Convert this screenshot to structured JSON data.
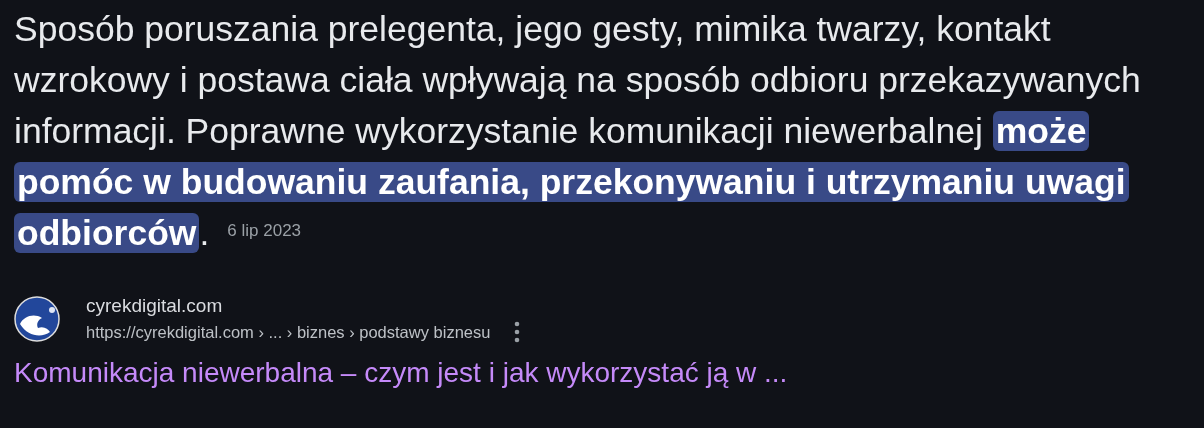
{
  "snippet": {
    "text": "Sposób poruszania prelegenta, jego gesty, mimika twarzy, kontakt wzrokowy i postawa ciała wpływają na sposób odbioru przekazywanych informacji. Poprawne wykorzystanie komunikacji niewerbalnej **może pomóc w budowaniu zaufania, przekonywaniu i utrzymaniu uwagi odbiorców**.",
    "date": "6 lip 2023"
  },
  "result": {
    "site_name": "cyrekdigital.com",
    "url": "https://cyrekdigital.com › ... › biznes › podstawy biznesu",
    "title": "Komunikacja niewerbalna – czym jest i jak wykorzystać ją w ..."
  }
}
